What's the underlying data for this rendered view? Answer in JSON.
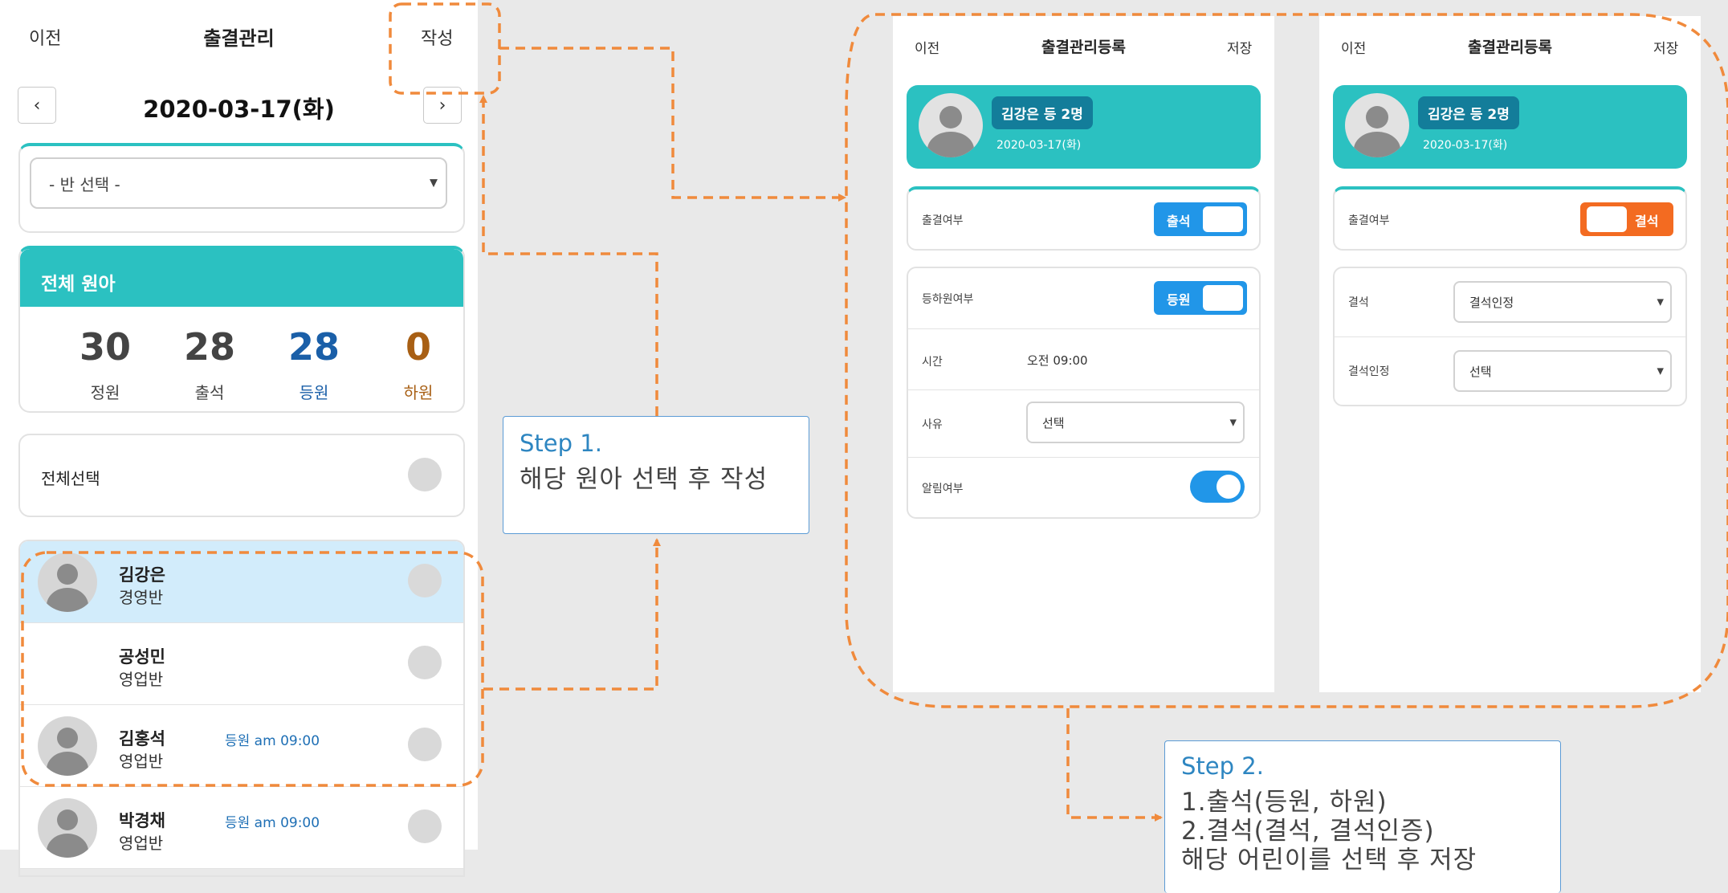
{
  "screen1": {
    "header": {
      "back": "이전",
      "title": "출결관리",
      "write": "작성"
    },
    "date": "2020-03-17(화)",
    "prev_icon": "chevron-left-icon",
    "next_icon": "chevron-right-icon",
    "class_select": {
      "value": "- 반 선택 -"
    },
    "stats": {
      "title": "전체 원아",
      "items": [
        {
          "value": "30",
          "label": "정원",
          "color": "#444444"
        },
        {
          "value": "28",
          "label": "출석",
          "color": "#444444"
        },
        {
          "value": "28",
          "label": "등원",
          "color": "#1a5fa8"
        },
        {
          "value": "0",
          "label": "하원",
          "color": "#a85f14"
        }
      ]
    },
    "select_all": "전체선택",
    "children": [
      {
        "name": "김강은",
        "class": "경영반",
        "status": ""
      },
      {
        "name": "공성민",
        "class": "영업반",
        "status": ""
      },
      {
        "name": "김홍석",
        "class": "영업반",
        "status": "등원 am 09:00"
      },
      {
        "name": "박경채",
        "class": "영업반",
        "status": "등원 am 09:00"
      }
    ]
  },
  "screen2": {
    "header": {
      "back": "이전",
      "title": "출결관리등록",
      "save": "저장"
    },
    "badge": "김강은 등 2명",
    "date": "2020-03-17(화)",
    "attendance": {
      "label": "출결여부",
      "toggle": "출석"
    },
    "arrival": {
      "label": "등하원여부",
      "toggle": "등원"
    },
    "time": {
      "label": "시간",
      "value": "오전 09:00"
    },
    "reason": {
      "label": "사유",
      "value": "선택"
    },
    "notify": {
      "label": "알림여부"
    }
  },
  "screen3": {
    "header": {
      "back": "이전",
      "title": "출결관리등록",
      "save": "저장"
    },
    "badge": "김강은 등 2명",
    "date": "2020-03-17(화)",
    "attendance": {
      "label": "출결여부",
      "toggle": "결석"
    },
    "absence": {
      "label": "결석",
      "value": "결석인정"
    },
    "absence_approval": {
      "label": "결석인정",
      "value": "선택"
    }
  },
  "step1": {
    "title": "Step 1.",
    "lines": [
      "해당 원아 선택 후 작성"
    ]
  },
  "step2": {
    "title": "Step 2.",
    "lines": [
      "1.출석(등원, 하원)",
      "2.결석(결석, 결석인증)",
      "해당 어린이를 선택 후 저장"
    ]
  },
  "colors": {
    "teal": "#2bc1c1",
    "blue": "#2196e8",
    "orange": "#f36b21",
    "annotation": "#f08a3c"
  }
}
